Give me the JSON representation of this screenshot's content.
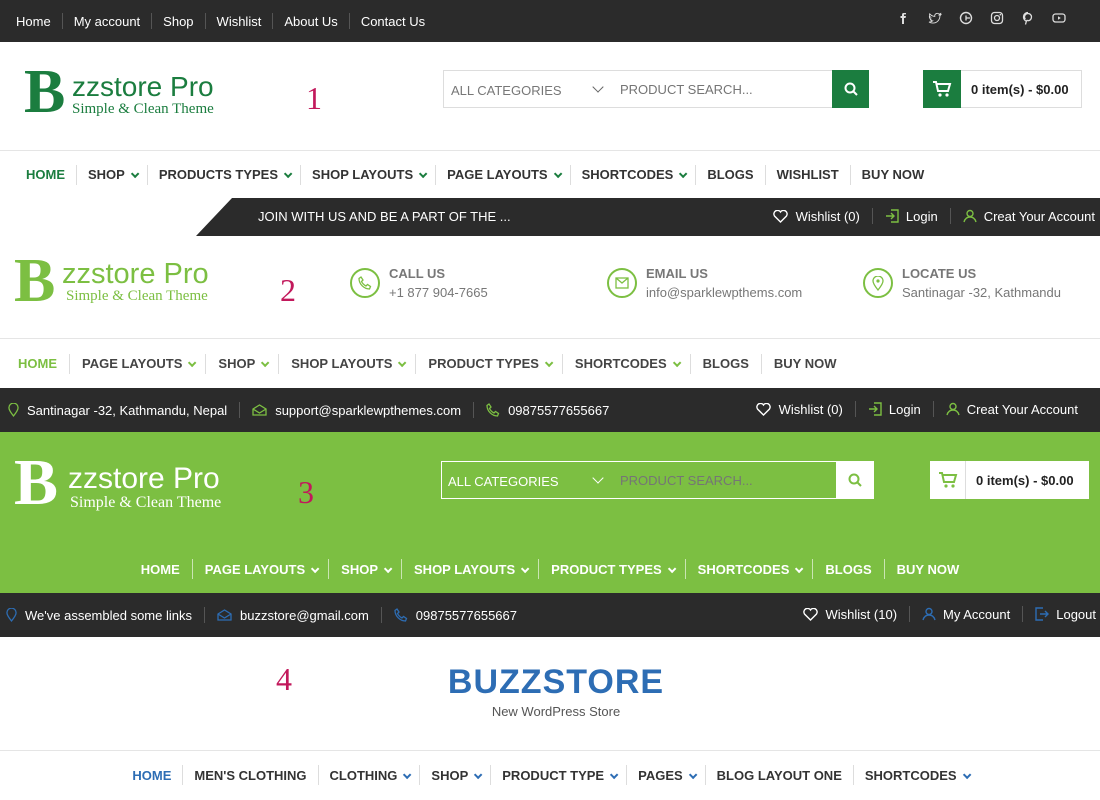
{
  "h1": {
    "topnav": [
      "Home",
      "My account",
      "Shop",
      "Wishlist",
      "About Us",
      "Contact Us"
    ],
    "social": [
      "facebook-icon",
      "twitter-icon",
      "google-plus-icon",
      "instagram-icon",
      "pinterest-icon",
      "youtube-icon"
    ],
    "logo_letter": "B",
    "logo_title": "zzstore Pro",
    "logo_tagline": "Simple & Clean Theme",
    "label": "1",
    "category_select": "ALL CATEGORIES",
    "search_placeholder": "PRODUCT SEARCH...",
    "cart": "0 item(s) - $0.00",
    "menu": [
      {
        "label": "HOME",
        "caret": false
      },
      {
        "label": "SHOP",
        "caret": true
      },
      {
        "label": "PRODUCTS TYPES",
        "caret": true
      },
      {
        "label": "SHOP LAYOUTS",
        "caret": true
      },
      {
        "label": "PAGE LAYOUTS",
        "caret": true
      },
      {
        "label": "SHORTCODES",
        "caret": true
      },
      {
        "label": "BLOGS",
        "caret": false
      },
      {
        "label": "WISHLIST",
        "caret": false
      },
      {
        "label": "BUY NOW",
        "caret": false
      }
    ],
    "accent": "#1b7d3f"
  },
  "h2": {
    "ticker": "JOIN WITH US AND BE A PART OF THE ...",
    "wishlist": "Wishlist (0)",
    "login": "Login",
    "create_account": "Creat Your Account",
    "logo_letter": "B",
    "logo_title": "zzstore Pro",
    "logo_tagline": "Simple & Clean Theme",
    "label": "2",
    "call_title": "CALL US",
    "call_value": "+1 877 904-7665",
    "email_title": "EMAIL US",
    "email_value": "info@sparklewpthems.com",
    "locate_title": "LOCATE US",
    "locate_value": "Santinagar -32, Kathmandu",
    "menu": [
      {
        "label": "HOME",
        "caret": false
      },
      {
        "label": "PAGE LAYOUTS",
        "caret": true
      },
      {
        "label": "SHOP",
        "caret": true
      },
      {
        "label": "SHOP LAYOUTS",
        "caret": true
      },
      {
        "label": "PRODUCT TYPES",
        "caret": true
      },
      {
        "label": "SHORTCODES",
        "caret": true
      },
      {
        "label": "BLOGS",
        "caret": false
      },
      {
        "label": "BUY NOW",
        "caret": false
      }
    ],
    "accent": "#7cbf42"
  },
  "h3": {
    "address": "Santinagar -32, Kathmandu, Nepal",
    "email": "support@sparklewpthemes.com",
    "phone": "09875577655667",
    "wishlist": "Wishlist (0)",
    "login": "Login",
    "create_account": "Creat Your Account",
    "logo_letter": "B",
    "logo_title": "zzstore Pro",
    "logo_tagline": "Simple & Clean Theme",
    "label": "3",
    "category_select": "ALL CATEGORIES",
    "search_placeholder": "PRODUCT SEARCH...",
    "cart": "0 item(s) - $0.00",
    "menu": [
      {
        "label": "HOME",
        "caret": false
      },
      {
        "label": "PAGE LAYOUTS",
        "caret": true
      },
      {
        "label": "SHOP",
        "caret": true
      },
      {
        "label": "SHOP LAYOUTS",
        "caret": true
      },
      {
        "label": "PRODUCT TYPES",
        "caret": true
      },
      {
        "label": "SHORTCODES",
        "caret": true
      },
      {
        "label": "BLOGS",
        "caret": false
      },
      {
        "label": "BUY NOW",
        "caret": false
      }
    ],
    "accent": "#7cbf42"
  },
  "h4": {
    "links": "We've assembled some links",
    "email": "buzzstore@gmail.com",
    "phone": "09875577655667",
    "wishlist": "Wishlist (10)",
    "account": "My Account",
    "logout": "Logout",
    "label": "4",
    "brand": "BUZZSTORE",
    "tagline": "New WordPress Store",
    "menu": [
      {
        "label": "HOME",
        "caret": false
      },
      {
        "label": "MEN'S CLOTHING",
        "caret": false
      },
      {
        "label": "CLOTHING",
        "caret": true
      },
      {
        "label": "SHOP",
        "caret": true
      },
      {
        "label": "PRODUCT TYPE",
        "caret": true
      },
      {
        "label": "PAGES",
        "caret": true
      },
      {
        "label": "BLOG LAYOUT ONE",
        "caret": false
      },
      {
        "label": "SHORTCODES",
        "caret": true
      }
    ],
    "accent": "#2d6db4"
  }
}
